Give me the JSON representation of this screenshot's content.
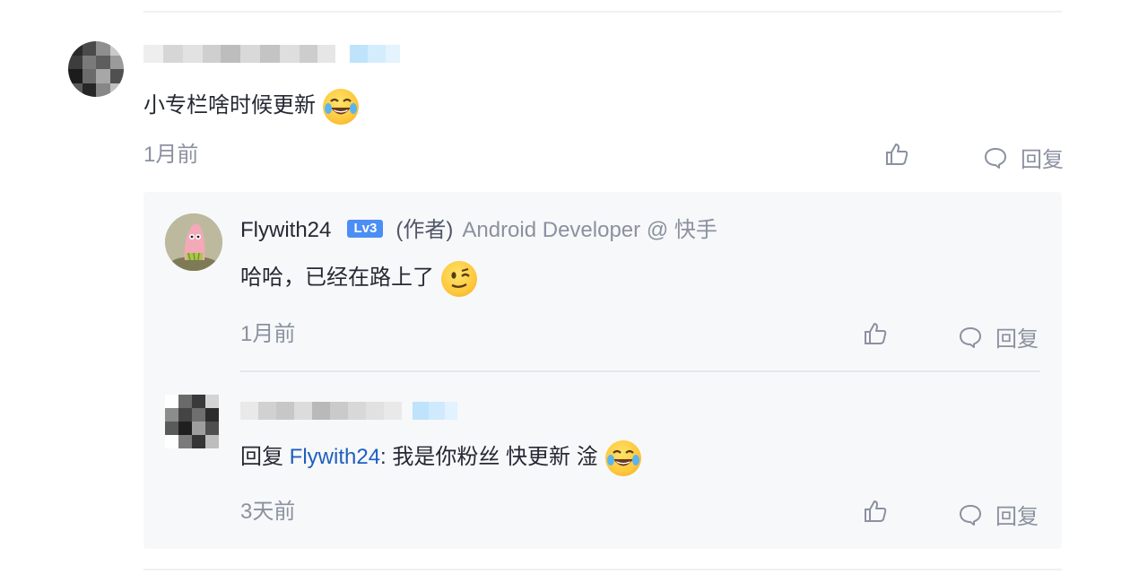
{
  "comment": {
    "text": "小专栏啥时候更新",
    "emoji": "laughing-with-tears",
    "time": "1月前",
    "reply_label": "回复"
  },
  "replies": [
    {
      "author": "Flywith24",
      "level": "Lv3",
      "role": "(作者)",
      "job": "Android Developer @ 快手",
      "text": "哈哈，已经在路上了",
      "emoji": "winking",
      "time": "1月前",
      "reply_label": "回复"
    },
    {
      "prefix": "回复",
      "mention": "Flywith24",
      "text": ": 我是你粉丝 快更新 淦",
      "emoji": "laughing-with-tears",
      "time": "3天前",
      "reply_label": "回复"
    }
  ],
  "colors": {
    "link": "#1e5fbf",
    "level_badge": "#4b8ef5",
    "meta": "#8a919f",
    "reply_bg": "#f7f8fa"
  }
}
